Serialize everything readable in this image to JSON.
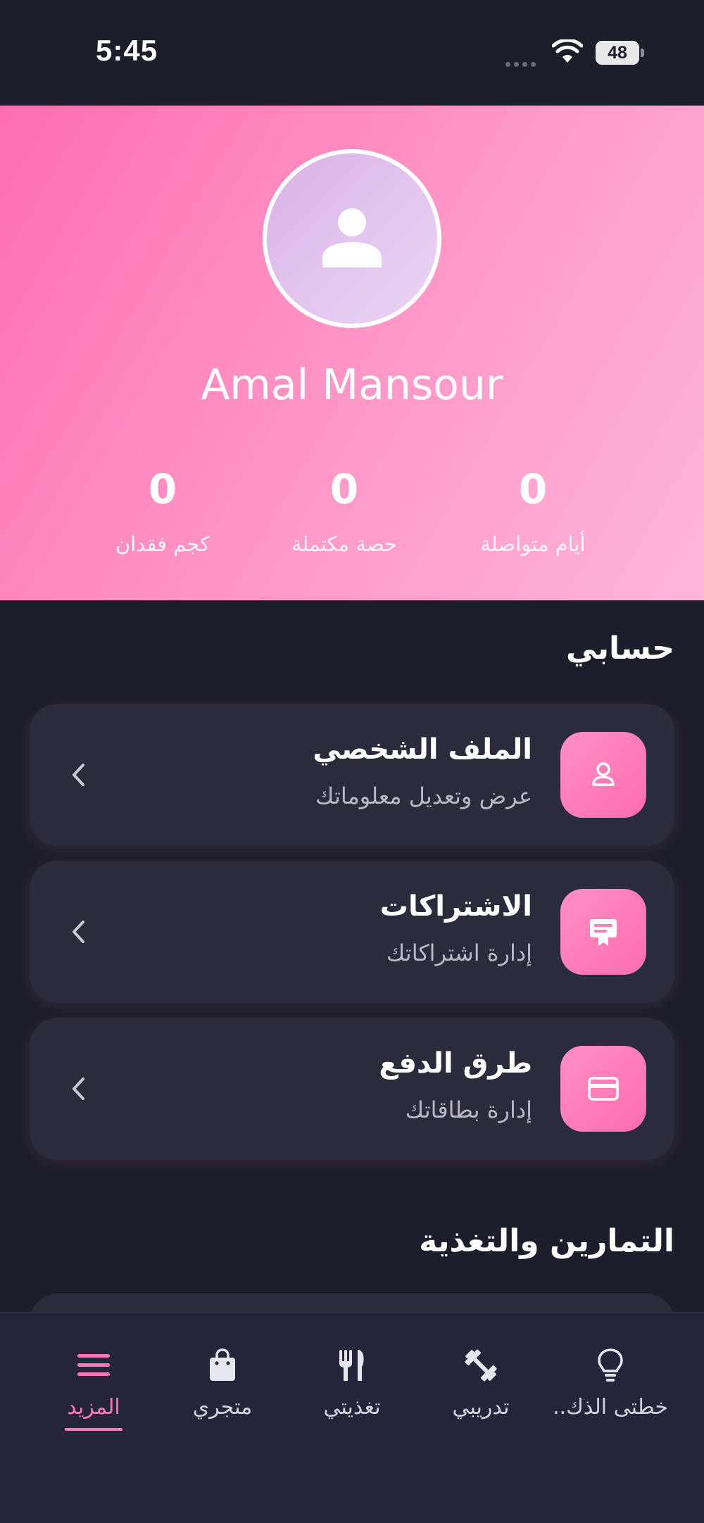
{
  "status_bar": {
    "time": "5:45",
    "battery": "48"
  },
  "profile": {
    "name": "Amal Mansour",
    "stats": [
      {
        "value": "0",
        "label": "أيام متواصلة"
      },
      {
        "value": "0",
        "label": "حصة مكتملة"
      },
      {
        "value": "0",
        "label": "كجم فقدان"
      }
    ]
  },
  "account_section": {
    "title": "حسابي",
    "items": [
      {
        "title": "الملف الشخصي",
        "subtitle": "عرض وتعديل معلوماتك",
        "icon": "user-icon"
      },
      {
        "title": "الاشتراكات",
        "subtitle": "إدارة اشتراكاتك",
        "icon": "certificate-icon"
      },
      {
        "title": "طرق الدفع",
        "subtitle": "إدارة بطاقاتك",
        "icon": "credit-card-icon"
      }
    ]
  },
  "training_section": {
    "title": "التمارين والتغذية"
  },
  "tab_bar": {
    "tabs": [
      {
        "label": "خطتى الذك..",
        "icon": "lightbulb-icon",
        "active": false
      },
      {
        "label": "تدريبي",
        "icon": "dumbbell-icon",
        "active": false
      },
      {
        "label": "تغذيتي",
        "icon": "utensils-icon",
        "active": false
      },
      {
        "label": "متجري",
        "icon": "shopping-bag-icon",
        "active": false
      },
      {
        "label": "المزيد",
        "icon": "menu-icon",
        "active": true
      }
    ]
  },
  "colors": {
    "accent": "#ff78b8",
    "background": "#1d1e2b",
    "card": "#2a2b3b",
    "hero_gradient_start": "#ff6eb0",
    "hero_gradient_end": "#ffb6da"
  }
}
